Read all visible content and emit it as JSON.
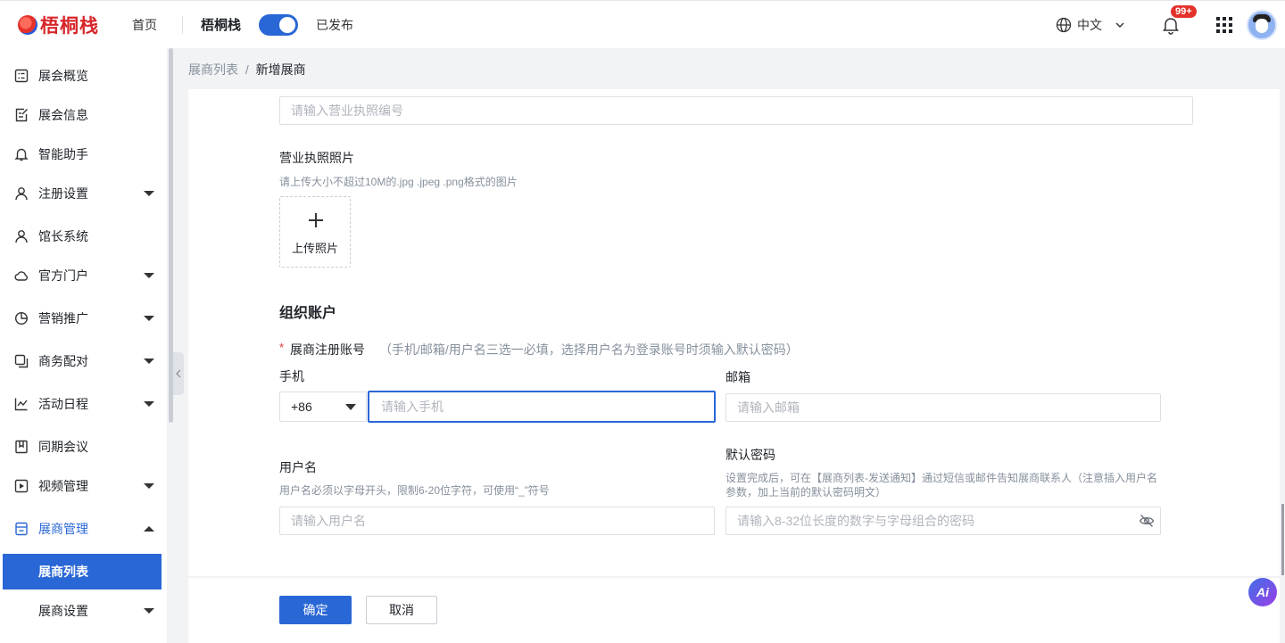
{
  "header": {
    "logo_text": "梧桐栈",
    "nav_home": "首页",
    "project_name": "梧桐栈",
    "publish_status": "已发布",
    "language": "中文",
    "notification_badge": "99+"
  },
  "sidebar": {
    "items": [
      {
        "label": "展会概览",
        "icon": "dashboard-icon"
      },
      {
        "label": "展会信息",
        "icon": "edit-doc-icon"
      },
      {
        "label": "智能助手",
        "icon": "bell-icon"
      },
      {
        "label": "注册设置",
        "icon": "user-icon"
      },
      {
        "label": "馆长系统",
        "icon": "user-icon"
      },
      {
        "label": "官方门户",
        "icon": "cloud-icon"
      },
      {
        "label": "营销推广",
        "icon": "pie-chart-icon"
      },
      {
        "label": "商务配对",
        "icon": "copy-icon"
      },
      {
        "label": "活动日程",
        "icon": "chart-icon"
      },
      {
        "label": "同期会议",
        "icon": "bookmark-icon"
      },
      {
        "label": "视频管理",
        "icon": "play-icon"
      },
      {
        "label": "展商管理",
        "icon": "store-icon"
      }
    ],
    "sub_items": [
      {
        "label": "展商列表"
      },
      {
        "label": "展商设置"
      }
    ]
  },
  "breadcrumb": {
    "parent": "展商列表",
    "separator": "/",
    "current": "新增展商"
  },
  "form": {
    "license_no_placeholder": "请输入营业执照编号",
    "license_photo_label": "营业执照照片",
    "license_photo_hint": "请上传大小不超过10M的.jpg .jpeg .png格式的图片",
    "upload_label": "上传照片",
    "section_title": "组织账户",
    "required_mark": "*",
    "account_label": "展商注册账号",
    "account_hint": "（手机/邮箱/用户名三选一必填，选择用户名为登录账号时须输入默认密码）",
    "phone_label": "手机",
    "country_code": "+86",
    "phone_placeholder": "请输入手机",
    "email_label": "邮箱",
    "email_placeholder": "请输入邮箱",
    "username_label": "用户名",
    "username_hint": "用户名必须以字母开头，限制6-20位字符，可使用“_”符号",
    "username_placeholder": "请输入用户名",
    "password_label": "默认密码",
    "password_hint_line1": "设置完成后，可在【展商列表-发送通知】通过短信或邮件告知展商联系人（注意插入用户名",
    "password_hint_line2": "参数，加上当前的默认密码明文）",
    "password_placeholder": "请输入8-32位长度的数字与字母组合的密码"
  },
  "buttons": {
    "confirm": "确定",
    "cancel": "取消"
  },
  "ai_button": "Ai",
  "colors": {
    "primary": "#2a67d6",
    "brand_red": "#d7262a"
  }
}
